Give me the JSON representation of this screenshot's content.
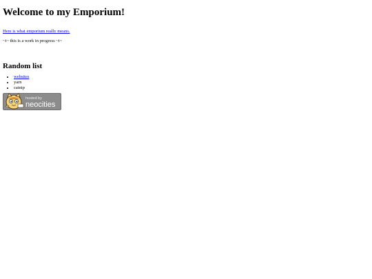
{
  "page": {
    "title": "Welcome to my Emporium!",
    "emporium_link": "Here is what emporium really means.",
    "wip_note": "~i~ this is a work in progress ~i~",
    "list_heading": "Random list",
    "list_items": [
      {
        "label": "websites",
        "is_link": true
      },
      {
        "label": "yarn",
        "is_link": false
      },
      {
        "label": "catnip",
        "is_link": false
      }
    ]
  },
  "badge": {
    "small_text": "hosted by",
    "brand_text": "neocities",
    "bg_color": "#8c8c8c",
    "icon": "neocities-cat-icon"
  }
}
